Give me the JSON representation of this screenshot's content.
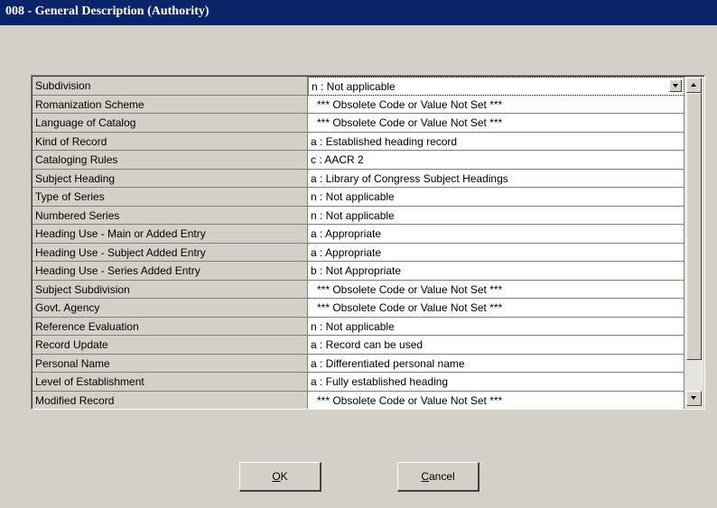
{
  "window": {
    "title": "008 - General Description (Authority)"
  },
  "grid": {
    "rows": [
      {
        "label": "Subdivision",
        "value": "n : Not applicable"
      },
      {
        "label": "Romanization Scheme",
        "value": "*** Obsolete Code or Value Not Set ***"
      },
      {
        "label": "Language of Catalog",
        "value": "*** Obsolete Code or Value Not Set ***"
      },
      {
        "label": "Kind of Record",
        "value": "a : Established heading record"
      },
      {
        "label": "Cataloging Rules",
        "value": "c : AACR 2"
      },
      {
        "label": "Subject Heading",
        "value": "a : Library of Congress Subject Headings"
      },
      {
        "label": "Type of Series",
        "value": "n : Not applicable"
      },
      {
        "label": "Numbered Series",
        "value": "n : Not applicable"
      },
      {
        "label": "Heading Use - Main or Added Entry",
        "value": "a : Appropriate"
      },
      {
        "label": "Heading Use - Subject Added Entry",
        "value": "a : Appropriate"
      },
      {
        "label": "Heading Use - Series Added Entry",
        "value": "b : Not Appropriate"
      },
      {
        "label": "Subject Subdivision",
        "value": "*** Obsolete Code or Value Not Set ***"
      },
      {
        "label": "Govt. Agency",
        "value": "*** Obsolete Code or Value Not Set ***"
      },
      {
        "label": "Reference Evaluation",
        "value": "n : Not applicable"
      },
      {
        "label": "Record Update",
        "value": "a : Record can be used"
      },
      {
        "label": "Personal Name",
        "value": "a : Differentiated personal name"
      },
      {
        "label": "Level of Establishment",
        "value": "a : Fully established heading"
      },
      {
        "label": "Modified Record",
        "value": "*** Obsolete Code or Value Not Set ***"
      }
    ]
  },
  "buttons": {
    "ok": {
      "mnemonic": "O",
      "rest": "K"
    },
    "cancel": {
      "mnemonic": "C",
      "rest": "ancel"
    }
  },
  "colors": {
    "title_bar": "#0a246a",
    "window_bg": "#d4d0c8"
  }
}
